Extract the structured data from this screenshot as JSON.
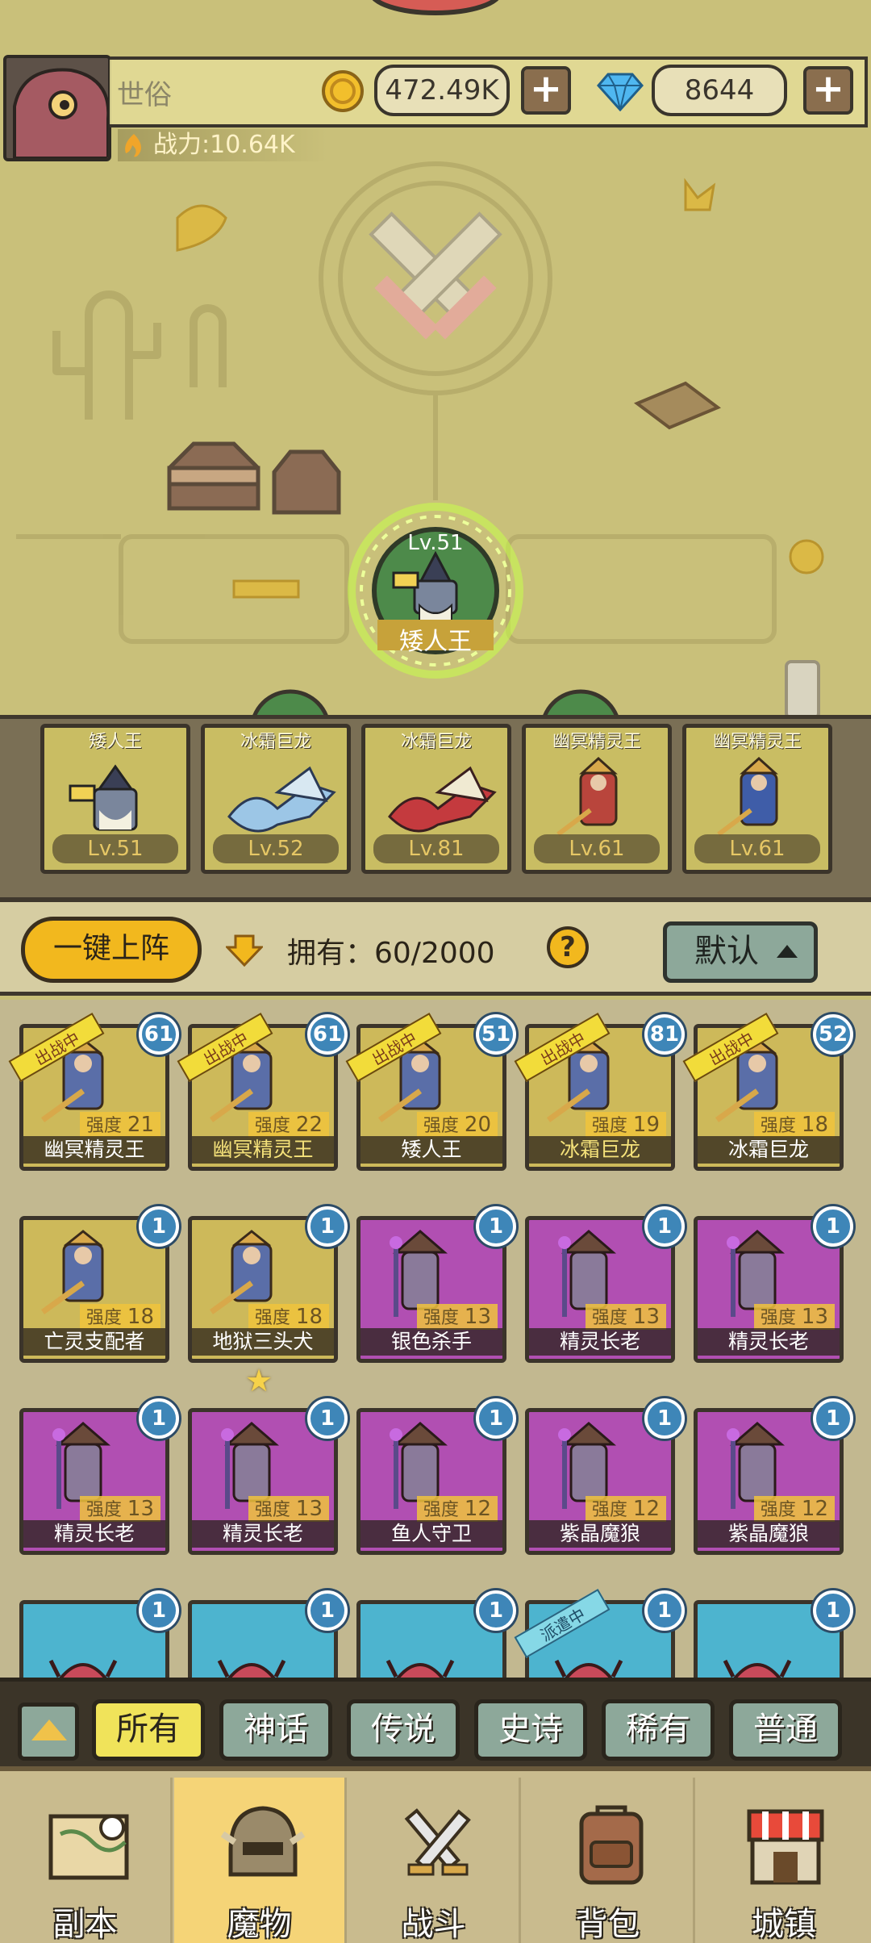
{
  "header": {
    "player_name": "世俗",
    "power_label": "战力:10.64K",
    "gold": "472.49K",
    "gems": "8644",
    "plus": "+"
  },
  "map": {
    "node_level": "Lv.51",
    "node_name": "矮人王",
    "colors": {
      "map_bg": "#c9c07a",
      "node_green": "#4d8a4a",
      "glow": "#c6ff4a"
    }
  },
  "team": [
    {
      "name": "矮人王",
      "level": "Lv.51"
    },
    {
      "name": "冰霜巨龙",
      "level": "Lv.52"
    },
    {
      "name": "冰霜巨龙",
      "level": "Lv.81"
    },
    {
      "name": "幽冥精灵王",
      "level": "Lv.61"
    },
    {
      "name": "幽冥精灵王",
      "level": "Lv.61"
    }
  ],
  "toolbar": {
    "deploy_label": "一键上阵",
    "owned_label": "拥有：60/2000",
    "help": "?",
    "sort_label": "默认"
  },
  "grid": {
    "strength_prefix": "强度",
    "deployed_ribbon": "出战中",
    "dispatch_ribbon": "派遣中",
    "monsters": [
      {
        "name": "幽冥精灵王",
        "level": "61",
        "strength": "21",
        "rarity": "gold",
        "deployed": true,
        "name_gold": false
      },
      {
        "name": "幽冥精灵王",
        "level": "61",
        "strength": "22",
        "rarity": "gold",
        "deployed": true,
        "name_gold": true
      },
      {
        "name": "矮人王",
        "level": "51",
        "strength": "20",
        "rarity": "gold",
        "deployed": true,
        "name_gold": false
      },
      {
        "name": "冰霜巨龙",
        "level": "81",
        "strength": "19",
        "rarity": "gold",
        "deployed": true,
        "name_gold": true
      },
      {
        "name": "冰霜巨龙",
        "level": "52",
        "strength": "18",
        "rarity": "gold",
        "deployed": true,
        "name_gold": false
      },
      {
        "name": "亡灵支配者",
        "level": "1",
        "strength": "18",
        "rarity": "gold",
        "deployed": false,
        "name_gold": false
      },
      {
        "name": "地狱三头犬",
        "level": "1",
        "strength": "18",
        "rarity": "gold",
        "deployed": false,
        "name_gold": false
      },
      {
        "name": "银色杀手",
        "level": "1",
        "strength": "13",
        "rarity": "purple",
        "deployed": false,
        "name_gold": false
      },
      {
        "name": "精灵长老",
        "level": "1",
        "strength": "13",
        "rarity": "purple",
        "deployed": false,
        "name_gold": false
      },
      {
        "name": "精灵长老",
        "level": "1",
        "strength": "13",
        "rarity": "purple",
        "deployed": false,
        "name_gold": false
      },
      {
        "name": "精灵长老",
        "level": "1",
        "strength": "13",
        "rarity": "purple",
        "deployed": false,
        "name_gold": false
      },
      {
        "name": "精灵长老",
        "level": "1",
        "strength": "13",
        "rarity": "purple",
        "deployed": false,
        "name_gold": false
      },
      {
        "name": "鱼人守卫",
        "level": "1",
        "strength": "12",
        "rarity": "purple",
        "deployed": false,
        "name_gold": false
      },
      {
        "name": "紫晶魔狼",
        "level": "1",
        "strength": "12",
        "rarity": "purple",
        "deployed": false,
        "name_gold": false
      },
      {
        "name": "紫晶魔狼",
        "level": "1",
        "strength": "12",
        "rarity": "purple",
        "deployed": false,
        "name_gold": false
      },
      {
        "name": "",
        "level": "1",
        "strength": "",
        "rarity": "blue",
        "deployed": false,
        "name_gold": false
      },
      {
        "name": "",
        "level": "1",
        "strength": "",
        "rarity": "blue",
        "deployed": false,
        "name_gold": false
      },
      {
        "name": "",
        "level": "1",
        "strength": "",
        "rarity": "blue",
        "deployed": false,
        "name_gold": false
      },
      {
        "name": "",
        "level": "1",
        "strength": "",
        "rarity": "blue",
        "deployed": false,
        "dispatched": true,
        "name_gold": false
      },
      {
        "name": "",
        "level": "1",
        "strength": "",
        "rarity": "blue",
        "deployed": false,
        "name_gold": false
      }
    ],
    "colors": {
      "gold": "#cdb95a",
      "purple": "#b14fb2",
      "blue": "#4db4cf"
    }
  },
  "filters": [
    "所有",
    "神话",
    "传说",
    "史诗",
    "稀有",
    "普通"
  ],
  "active_filter": "所有",
  "nav": [
    {
      "label": "副本",
      "icon": "map-scroll-icon"
    },
    {
      "label": "魔物",
      "icon": "helmet-icon"
    },
    {
      "label": "战斗",
      "icon": "crossed-swords-icon"
    },
    {
      "label": "背包",
      "icon": "backpack-icon"
    },
    {
      "label": "城镇",
      "icon": "shop-icon"
    }
  ],
  "active_nav": "魔物"
}
